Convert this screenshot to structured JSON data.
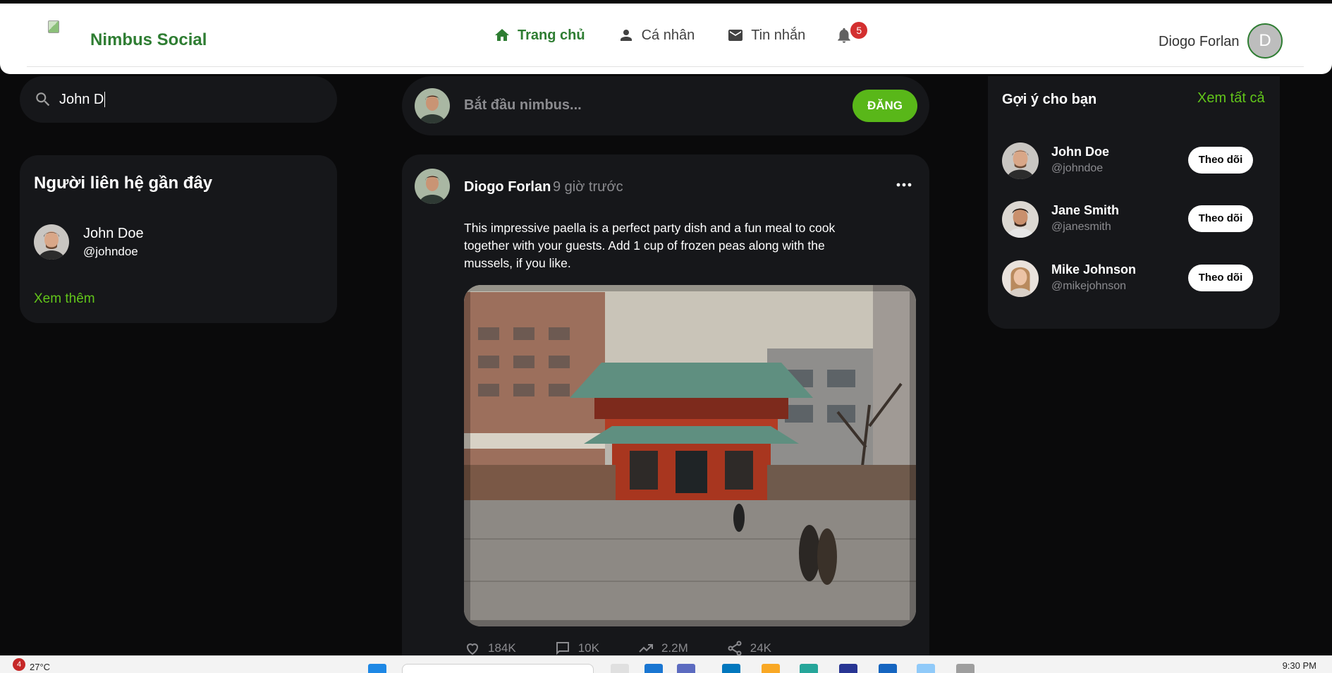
{
  "app": {
    "brand": "Nimbus Social"
  },
  "nav": {
    "home": "Trang chủ",
    "profile": "Cá nhân",
    "messages": "Tin nhắn",
    "notification_count": "5"
  },
  "user": {
    "name": "Diogo Forlan",
    "initial": "D"
  },
  "search": {
    "value": "John D"
  },
  "contacts": {
    "title": "Người liên hệ gần đây",
    "items": [
      {
        "name": "John Doe",
        "handle": "@johndoe"
      }
    ],
    "see_more": "Xem thêm"
  },
  "composer": {
    "placeholder": "Bắt đầu nimbus...",
    "post_label": "ĐĂNG"
  },
  "post": {
    "author": "Diogo Forlan",
    "time": "9 giờ trước",
    "text": "This impressive paella is a perfect party dish and a fun meal to cook together with your guests. Add 1 cup of frozen peas along with the mussels, if you like.",
    "likes": "184K",
    "comments": "10K",
    "views": "2.2M",
    "shares": "24K"
  },
  "suggestions": {
    "title": "Gợi ý cho bạn",
    "see_all": "Xem tất cả",
    "follow_label": "Theo dõi",
    "items": [
      {
        "name": "John Doe",
        "handle": "@johndoe"
      },
      {
        "name": "Jane Smith",
        "handle": "@janesmith"
      },
      {
        "name": "Mike Johnson",
        "handle": "@mikejohnson"
      }
    ]
  },
  "taskbar": {
    "weather": "27°C",
    "weather_badge": "4",
    "time": "9:30 PM"
  },
  "colors": {
    "brand": "#2e7d32",
    "accent": "#59b719",
    "link": "#62c61a",
    "badge": "#d32f2f",
    "panel": "#16171a",
    "background": "#0a0a0b"
  }
}
